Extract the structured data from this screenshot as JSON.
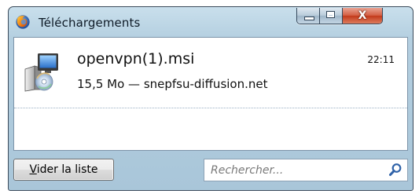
{
  "window": {
    "title": "Téléchargements",
    "app_icon": "firefox-icon",
    "controls": {
      "minimize_icon": "minimize-icon",
      "maximize_icon": "maximize-icon",
      "close_icon": "close-icon",
      "close_glyph": "X"
    },
    "accent_color": "#b4cfe0",
    "close_color": "#c2391a"
  },
  "downloads": [
    {
      "icon": "msi-installer-icon",
      "name": "openvpn(1).msi",
      "time": "22:11",
      "details": "15,5 Mo — snepfsu-diffusion.net"
    }
  ],
  "footer": {
    "clear_button": {
      "accel": "V",
      "rest": "ider la liste"
    },
    "search": {
      "placeholder": "Rechercher...",
      "value": "",
      "icon": "search-icon"
    }
  }
}
